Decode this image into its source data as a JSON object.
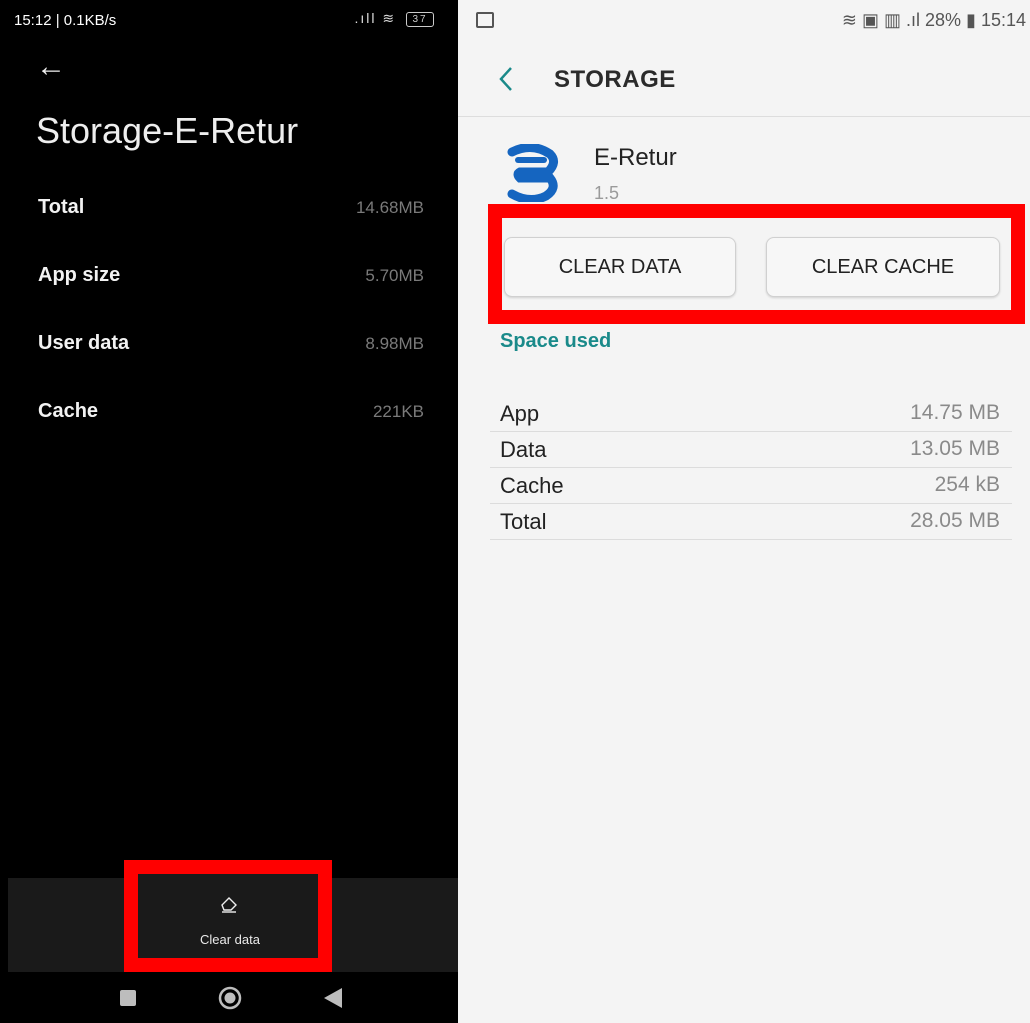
{
  "left": {
    "status": {
      "time": "15:12 | 0.1KB/s",
      "icons": ".ıll ≋",
      "battery": "37"
    },
    "title": "Storage-E-Retur",
    "rows": [
      {
        "label": "Total",
        "value": "14.68MB"
      },
      {
        "label": "App size",
        "value": "5.70MB"
      },
      {
        "label": "User data",
        "value": "8.98MB"
      },
      {
        "label": "Cache",
        "value": "221KB"
      }
    ],
    "clear_data_label": "Clear data"
  },
  "right": {
    "status": {
      "text": "≋ ▣ ▥ .ıl 28% ▮ 15:14"
    },
    "header": "STORAGE",
    "app": {
      "name": "E-Retur",
      "version": "1.5"
    },
    "buttons": {
      "clear_data": "CLEAR DATA",
      "clear_cache": "CLEAR CACHE"
    },
    "space_used_label": "Space used",
    "rows": [
      {
        "label": "App",
        "value": "14.75 MB"
      },
      {
        "label": "Data",
        "value": "13.05 MB"
      },
      {
        "label": "Cache",
        "value": "254 kB"
      },
      {
        "label": "Total",
        "value": "28.05 MB"
      }
    ]
  },
  "colors": {
    "highlight": "#ff0000",
    "accent_teal": "#1a8a8a",
    "app_icon_blue": "#1565c0"
  }
}
